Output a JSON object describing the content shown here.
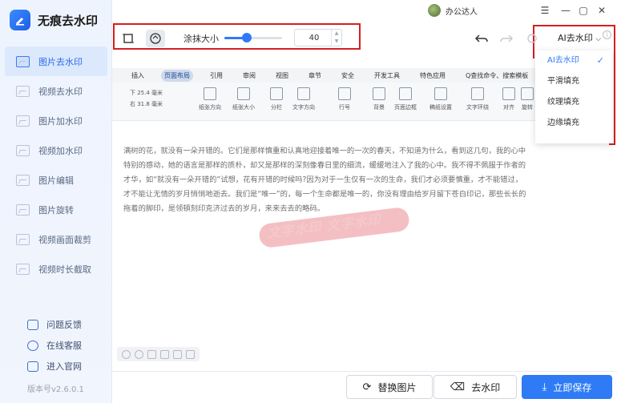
{
  "app": {
    "name": "无痕去水印",
    "version": "版本号v2.6.0.1"
  },
  "user": {
    "name": "办公达人"
  },
  "window": {
    "minimize": "—",
    "restore": "▢",
    "close": "✕",
    "menu": "☰"
  },
  "sidebar": {
    "items": [
      {
        "label": "图片去水印",
        "active": true
      },
      {
        "label": "视频去水印"
      },
      {
        "label": "图片加水印"
      },
      {
        "label": "视频加水印"
      },
      {
        "label": "图片编辑"
      },
      {
        "label": "图片旋转"
      },
      {
        "label": "视频画面裁剪"
      },
      {
        "label": "视频时长截取"
      }
    ],
    "links": [
      {
        "label": "问题反馈",
        "icon": "feedback-icon"
      },
      {
        "label": "在线客服",
        "icon": "headset-icon"
      },
      {
        "label": "进入官网",
        "icon": "website-icon"
      }
    ]
  },
  "toolbar": {
    "brush_label": "涂抹大小",
    "brush_size": "40",
    "brush_level": 0.4,
    "mode_label": "AI去水印",
    "icons": [
      "rect-select-icon",
      "brush-icon",
      "undo-icon",
      "redo-icon",
      "reset-icon"
    ]
  },
  "dropdown": {
    "options": [
      "AI去水印",
      "平滑填充",
      "纹理填充",
      "边缘填充"
    ],
    "selected": "AI去水印"
  },
  "doc": {
    "tabs": [
      "插入",
      "页面布局",
      "引用",
      "审阅",
      "视图",
      "章节",
      "安全",
      "开发工具",
      "特色应用",
      "Q查找命令、搜索模板"
    ],
    "active_tab": "页面布局",
    "ribbon": [
      "纸张方向",
      "纸张大小",
      "分栏",
      "文字方向",
      "行号",
      "背景",
      "页面边框",
      "稿纸设置",
      "文字环绕",
      "对齐",
      "旋转"
    ],
    "margins": [
      "下 25.4 毫米",
      "右 31.8 毫米"
    ],
    "lines": [
      "满树的花，就没有一朵开错的。它们是那样慎重和认真地迎接着唯一的一次的春天，不知道为什么，看到这几句，我的心中",
      "特别的感动，她的语言是那样的质朴，却又是那样的深刻像春日里的细流，缓缓地注入了我的心中。我不得不佩服于作者的",
      "才华，如“就没有一朵开错的”试想，花有开错的时候吗?因为对于一生仅有一次的生命，我们才必须要慎重，才不能错过，",
      "才不能让无情的岁月悄悄地逝去。我们是“唯一”的，每一个生命都是唯一的，你没有理由给岁月留下苍白印记，那些长长的",
      "拖着的脚印，是领頓刻印克济过去的岁月，来来去去的略码。"
    ],
    "watermark": "文字水印 文字水印"
  },
  "actions": {
    "replace": "替换图片",
    "remove": "去水印",
    "save": "立即保存"
  }
}
